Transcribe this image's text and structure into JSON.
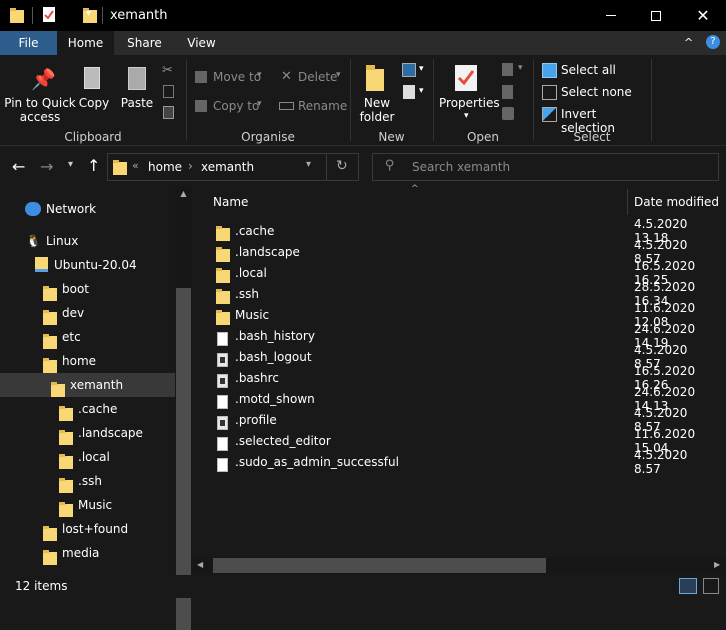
{
  "window": {
    "title": "xemanth"
  },
  "tabs": {
    "file": "File",
    "home": "Home",
    "share": "Share",
    "view": "View"
  },
  "ribbon": {
    "clipboard": {
      "pin": "Pin to Quick access",
      "copy": "Copy",
      "paste": "Paste",
      "group": "Clipboard"
    },
    "organise": {
      "move_to": "Move to",
      "copy_to": "Copy to",
      "delete": "Delete",
      "rename": "Rename",
      "group": "Organise"
    },
    "new": {
      "new_folder": "New folder",
      "group": "New"
    },
    "open": {
      "properties": "Properties",
      "group": "Open"
    },
    "select": {
      "select_all": "Select all",
      "select_none": "Select none",
      "invert": "Invert selection",
      "group": "Select"
    }
  },
  "address": {
    "path1": "home",
    "path2": "xemanth",
    "search_placeholder": "Search xemanth"
  },
  "tree": [
    {
      "label": "Network",
      "type": "network"
    },
    {
      "label": "Linux",
      "type": "linux"
    },
    {
      "label": "Ubuntu-20.04",
      "type": "drive"
    },
    {
      "label": "boot",
      "type": "folder"
    },
    {
      "label": "dev",
      "type": "folder"
    },
    {
      "label": "etc",
      "type": "folder"
    },
    {
      "label": "home",
      "type": "folder"
    },
    {
      "label": "xemanth",
      "type": "folder"
    },
    {
      "label": ".cache",
      "type": "folder"
    },
    {
      "label": ".landscape",
      "type": "folder"
    },
    {
      "label": ".local",
      "type": "folder"
    },
    {
      "label": ".ssh",
      "type": "folder"
    },
    {
      "label": "Music",
      "type": "folder"
    },
    {
      "label": "lost+found",
      "type": "folder"
    },
    {
      "label": "media",
      "type": "folder"
    }
  ],
  "columns": {
    "name": "Name",
    "date": "Date modified"
  },
  "files": [
    {
      "name": ".cache",
      "date": "4.5.2020 13.18",
      "type": "folder"
    },
    {
      "name": ".landscape",
      "date": "4.5.2020 8.57",
      "type": "folder"
    },
    {
      "name": ".local",
      "date": "16.5.2020 16.25",
      "type": "folder"
    },
    {
      "name": ".ssh",
      "date": "28.5.2020 16.34",
      "type": "folder"
    },
    {
      "name": "Music",
      "date": "11.6.2020 12.08",
      "type": "folder"
    },
    {
      "name": ".bash_history",
      "date": "24.6.2020 14.19",
      "type": "file"
    },
    {
      "name": ".bash_logout",
      "date": "4.5.2020 8.57",
      "type": "script"
    },
    {
      "name": ".bashrc",
      "date": "16.5.2020 16.26",
      "type": "script"
    },
    {
      "name": ".motd_shown",
      "date": "24.6.2020 14.13",
      "type": "file"
    },
    {
      "name": ".profile",
      "date": "4.5.2020 8.57",
      "type": "script"
    },
    {
      "name": ".selected_editor",
      "date": "11.6.2020 15.04",
      "type": "file"
    },
    {
      "name": ".sudo_as_admin_successful",
      "date": "4.5.2020 8.57",
      "type": "file"
    }
  ],
  "status": {
    "count": "12 items"
  },
  "colors": {
    "folder": "#f8d775",
    "folder_dark": "#e5b94d",
    "accent_blue": "#4aa3e8",
    "properties_check": "#e74c3c"
  }
}
